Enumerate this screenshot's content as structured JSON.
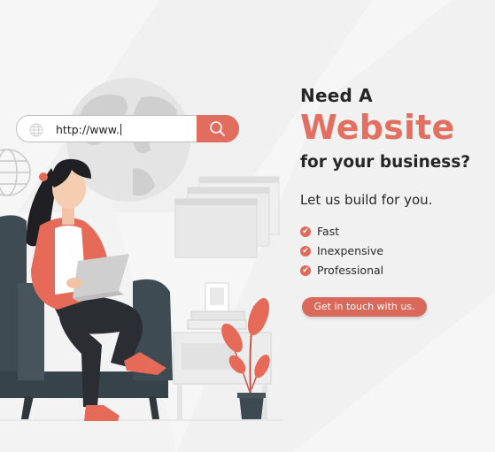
{
  "headline": {
    "line1": "Need  A",
    "line2": "Website",
    "line3": "for your business?"
  },
  "subheading": "Let us build for you.",
  "features": [
    "Fast",
    "Inexpensive",
    "Professional"
  ],
  "cta_label": "Get in touch with us.",
  "url_bar": {
    "text": "http://www.",
    "globe_icon": "globe-icon",
    "search_icon": "search-icon"
  },
  "colors": {
    "accent": "#e06d5d",
    "text": "#262626",
    "background": "#f6f6f6"
  }
}
